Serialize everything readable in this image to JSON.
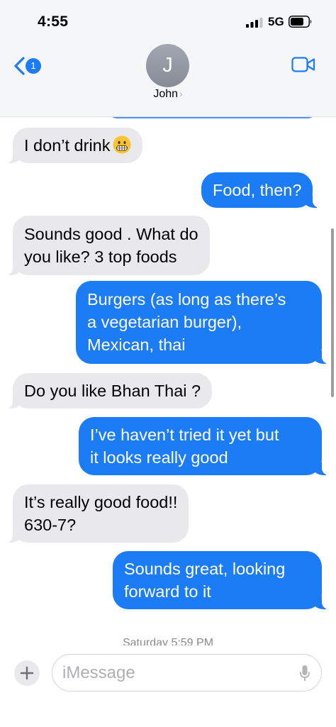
{
  "status_bar": {
    "time": "4:55",
    "network": "5G"
  },
  "header": {
    "back_badge_count": "1",
    "avatar_initial": "J",
    "contact_name": "John",
    "contact_chevron": "›"
  },
  "icons": {
    "back": "chevron-left-icon",
    "video": "video-camera-icon",
    "add": "plus-icon",
    "mic": "microphone-icon",
    "emoji": "grimacing-face-emoji"
  },
  "colors": {
    "outgoing_bubble": "#1b7cf5",
    "incoming_bubble": "#e9e9eb",
    "accent": "#1b7cf5"
  },
  "messages": [
    {
      "direction": "incoming",
      "lines": [
        "I don’t drink"
      ],
      "emoji": "grimacing-face-emoji"
    },
    {
      "direction": "outgoing",
      "lines": [
        "Food, then?"
      ]
    },
    {
      "direction": "incoming",
      "lines": [
        "Sounds good . What do",
        "you like? 3 top foods"
      ]
    },
    {
      "direction": "outgoing",
      "lines": [
        "Burgers (as long as there’s",
        "a vegetarian burger),",
        "Mexican, thai"
      ]
    },
    {
      "direction": "incoming",
      "lines": [
        "Do you like Bhan Thai ?"
      ]
    },
    {
      "direction": "outgoing",
      "lines": [
        "I’ve haven’t tried it yet but",
        "it looks really good"
      ]
    },
    {
      "direction": "incoming",
      "lines": [
        "It’s really good food!!",
        "630-7?"
      ]
    },
    {
      "direction": "outgoing",
      "lines": [
        "Sounds great, looking",
        "forward to it"
      ]
    }
  ],
  "timestamp": "Saturday 5:59 PM",
  "composer": {
    "placeholder": "iMessage",
    "value": ""
  }
}
